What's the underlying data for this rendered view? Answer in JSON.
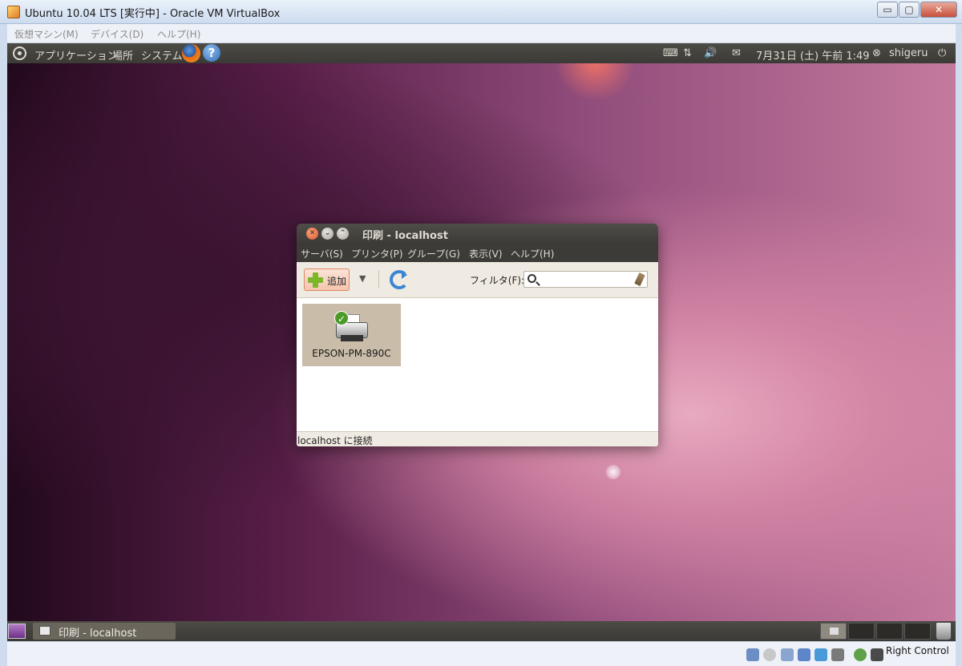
{
  "host": {
    "title": "Ubuntu 10.04 LTS [実行中] - Oracle VM VirtualBox",
    "menu": [
      "仮想マシン(M)",
      "デバイス(D)",
      "ヘルプ(H)"
    ],
    "controls": {
      "min": "▭",
      "max": "▢",
      "close": "✕"
    },
    "status_label": "Right Control"
  },
  "guest_panel": {
    "menus": [
      "アプリケーション",
      "場所",
      "システム"
    ],
    "tray": {
      "keyboard": "⌨",
      "network": "⇅",
      "volume": "🔊",
      "mail": "✉"
    },
    "clock": "7月31日 (土) 午前 1:49",
    "user": "shigeru",
    "power": "⏻"
  },
  "print_window": {
    "title": "印刷 - localhost",
    "menus": [
      "サーバ(S)",
      "プリンタ(P)",
      "グループ(G)",
      "表示(V)",
      "ヘルプ(H)"
    ],
    "add_label": "追加",
    "filter_label": "フィルタ(F):",
    "filter_value": "",
    "printers": [
      {
        "name": "EPSON-PM-890C",
        "status": "default"
      }
    ],
    "status_text": "localhost に接続"
  },
  "taskbar": {
    "task_label": "印刷 - localhost"
  },
  "colors": {
    "panel_bg": "#3c3b37",
    "accent_orange": "#e0562a",
    "wallpaper_base": "#5a1f4a"
  }
}
